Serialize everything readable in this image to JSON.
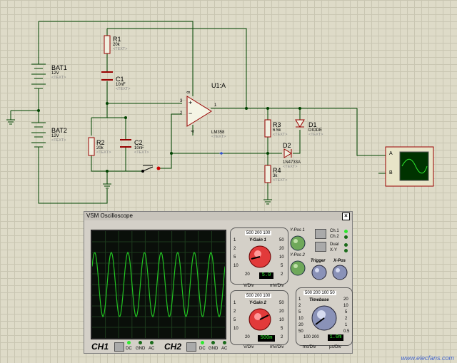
{
  "schematic": {
    "bat1": {
      "name": "BAT1",
      "value": "12V",
      "text": "<TEXT>"
    },
    "bat2": {
      "name": "BAT2",
      "value": "12V",
      "text": "<TEXT>"
    },
    "r1": {
      "name": "R1",
      "value": "20k",
      "text": "<TEXT>"
    },
    "c1": {
      "name": "C1",
      "value": "10nF",
      "text": "<TEXT>"
    },
    "r2": {
      "name": "R2",
      "value": "20k",
      "text": "<TEXT>"
    },
    "c2": {
      "name": "C2",
      "value": "10nF",
      "text": "<TEXT>"
    },
    "u1": {
      "name": "U1:A",
      "value": "LM358",
      "text": "<TEXT>",
      "pin_plus": "3",
      "pin_minus": "2",
      "pin_out": "1",
      "pin_v8": "8",
      "pin_v4": "4"
    },
    "r3": {
      "name": "R3",
      "value": "6.5k",
      "text": "<TEXT>"
    },
    "r4": {
      "name": "R4",
      "value": "3k",
      "text": "<TEXT>"
    },
    "d1": {
      "name": "D1",
      "value": "DIODE",
      "text": "<TEXT>"
    },
    "d2": {
      "name": "D2",
      "value": "1N4733A",
      "text": "<TEXT>"
    },
    "scope_symbol": {
      "a": "A",
      "b": "B"
    }
  },
  "oscilloscope": {
    "title": "VSM Oscilloscope",
    "close": "×",
    "ch1_label": "CH1",
    "ch2_label": "CH2",
    "coupling": [
      "DC",
      "GND",
      "AC"
    ],
    "ygain1": {
      "title": "Y-Gain 1",
      "scale_top": "500 200 100",
      "left_scale": [
        "1",
        "2",
        "5",
        "10",
        "20"
      ],
      "right_scale": [
        "50",
        "20",
        "10",
        "5",
        "2"
      ],
      "readout": "5.0",
      "unit_left": "V/Div",
      "unit_right": "mV/Div"
    },
    "ygain2": {
      "title": "Y-Gain 2",
      "scale_top": "500 200 100",
      "left_scale": [
        "1",
        "2",
        "5",
        "10",
        "20"
      ],
      "right_scale": [
        "50",
        "20",
        "10",
        "5",
        "2"
      ],
      "readout": "500m",
      "unit_left": "V/Div",
      "unit_right": "mV/Div"
    },
    "ypos1": "Y-Pos 1",
    "ypos2": "Y-Pos 2",
    "ch_select": [
      "Ch.1",
      "Ch.2",
      "Dual",
      "X-Y"
    ],
    "trigger": "Trigger",
    "xpos": "X-Pos",
    "timebase": {
      "title": "Timebase",
      "scale_top": "500 200 100 50",
      "scale_bottom": "100 200",
      "left_scale": [
        "1",
        "2",
        "5",
        "10",
        "20",
        "50"
      ],
      "right_scale": [
        "20",
        "10",
        "5",
        "2",
        "1",
        "0.5"
      ],
      "readout": "1.0m",
      "unit_left": "ms/Div",
      "unit_right": "µs/Div"
    }
  },
  "watermark": "www.elecfans.com",
  "colors": {
    "trace": "#22c422",
    "wire": "#004400",
    "component": "#990000"
  }
}
